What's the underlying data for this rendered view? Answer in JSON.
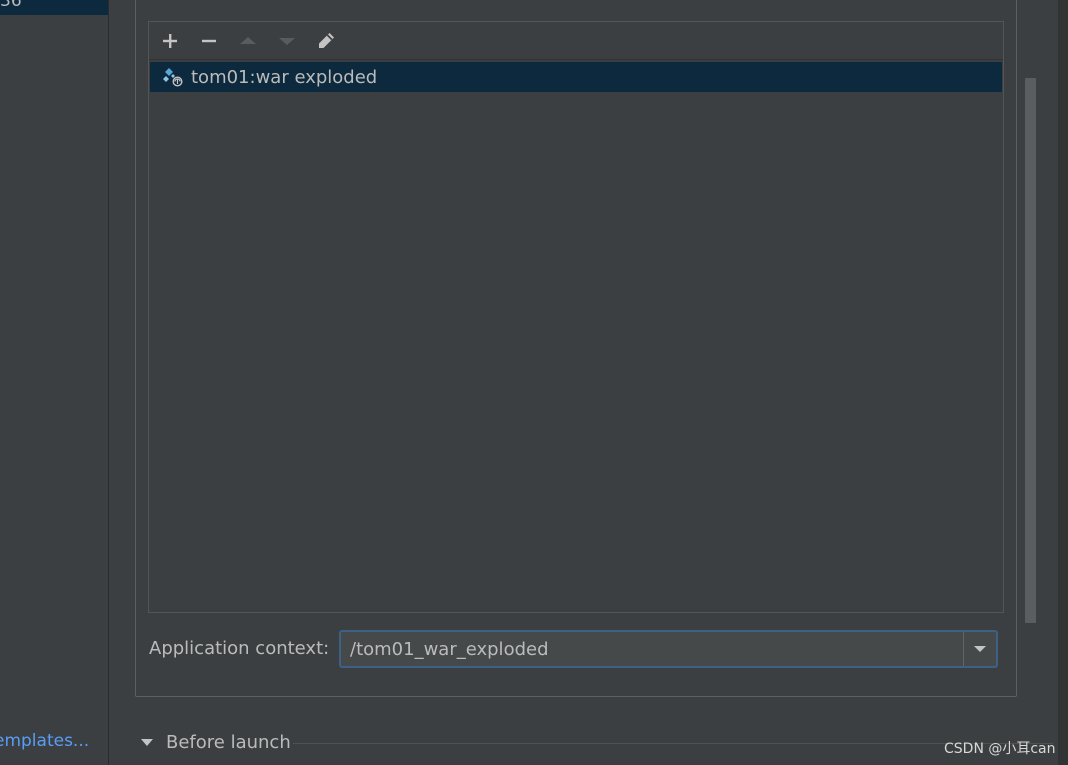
{
  "sidebar": {
    "selected_item_fragment": "36",
    "templates_link": "emplates..."
  },
  "deployment": {
    "toolbar": {
      "add_icon": "plus-icon",
      "remove_icon": "minus-icon",
      "move_up_icon": "arrow-up-icon",
      "move_down_icon": "arrow-down-icon",
      "edit_icon": "pencil-icon"
    },
    "artifacts": [
      {
        "label": "tom01:war exploded",
        "icon": "war-exploded-artifact-icon"
      }
    ]
  },
  "application_context": {
    "label": "Application context:",
    "value": "/tom01_war_exploded"
  },
  "before_launch": {
    "label": "Before launch"
  },
  "watermark": "CSDN @小耳can",
  "colors": {
    "background": "#3c3f41",
    "selection": "#0d293e",
    "link": "#589df6",
    "focus_border": "#3d6185",
    "text": "#bbbbbb"
  }
}
